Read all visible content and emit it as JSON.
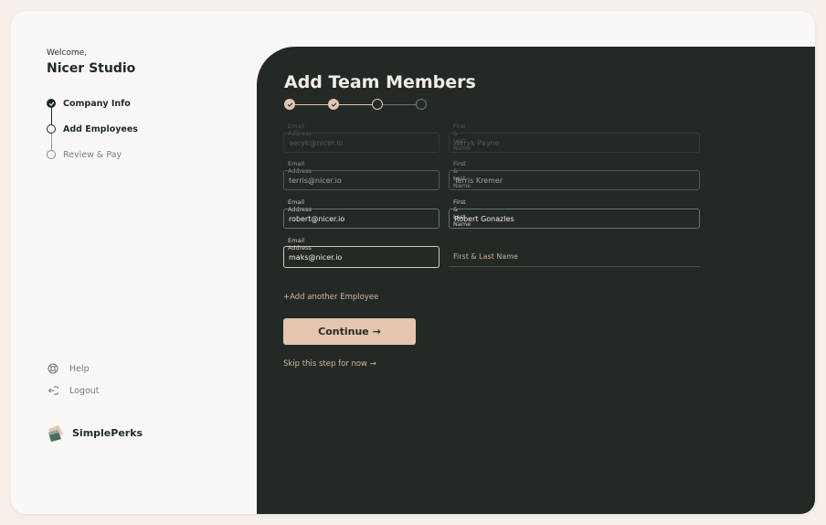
{
  "sidebar": {
    "welcome": "Welcome,",
    "studio": "Nicer Studio",
    "steps": [
      {
        "label": "Company Info",
        "state": "done"
      },
      {
        "label": "Add Employees",
        "state": "current"
      },
      {
        "label": "Review & Pay",
        "state": "todo"
      }
    ],
    "help": "Help",
    "logout": "Logout",
    "brand": "SimplePerks"
  },
  "main": {
    "title": "Add Team Members",
    "progress": {
      "completed": 2,
      "current": 3,
      "total": 4
    },
    "rows": [
      {
        "email_label": "Email Address",
        "email": "aeryk@nicer.io",
        "name_label": "First & Last Name",
        "name": "Aeryk Payne"
      },
      {
        "email_label": "Email Address",
        "email": "terris@nicer.io",
        "name_label": "First & Last Name",
        "name": "Terris Kremer"
      },
      {
        "email_label": "Email Address",
        "email": "robert@nicer.io",
        "name_label": "First & Last Name",
        "name": "Robert Gonazles"
      },
      {
        "email_label": "Email Address",
        "email": "maks@nicer.io",
        "name_placeholder": "First & Last Name"
      }
    ],
    "add_link": "+Add another Employee",
    "continue_label": "Continue →",
    "skip_link": "Skip this step for now →"
  },
  "colors": {
    "panel": "#232a26",
    "accent": "#e4c5ad",
    "sidebar_bg": "#faf8f6",
    "text_dark": "#1f2a25"
  }
}
